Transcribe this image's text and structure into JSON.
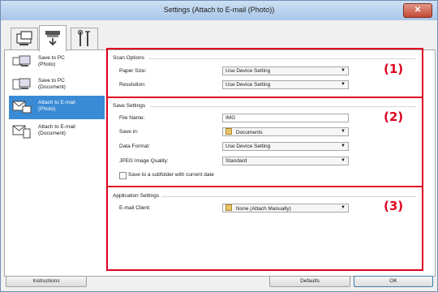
{
  "window": {
    "title": "Settings (Attach to E-mail (Photo))"
  },
  "tabs": [
    {
      "name": "scan-from-computer",
      "active": false
    },
    {
      "name": "scan-from-panel",
      "active": true
    },
    {
      "name": "general-settings",
      "active": false
    }
  ],
  "sidebar": {
    "items": [
      {
        "label": "Save to PC\n(Photo)",
        "selected": false
      },
      {
        "label": "Save to PC\n(Document)",
        "selected": false
      },
      {
        "label": "Attach to E-mail\n(Photo)",
        "selected": true
      },
      {
        "label": "Attach to E-mail\n(Document)",
        "selected": false
      }
    ]
  },
  "scan_options": {
    "title": "Scan Options",
    "paper_size_label": "Paper Size:",
    "paper_size_value": "Use Device Setting",
    "resolution_label": "Resolution:",
    "resolution_value": "Use Device Setting",
    "marker": "(1)"
  },
  "save_settings": {
    "title": "Save Settings",
    "file_name_label": "File Name:",
    "file_name_value": "IMG",
    "save_in_label": "Save in:",
    "save_in_value": "Documents",
    "data_format_label": "Data Format:",
    "data_format_value": "Use Device Setting",
    "jpeg_quality_label": "JPEG Image Quality:",
    "jpeg_quality_value": "Standard",
    "subfolder_label": "Save to a subfolder with current date",
    "subfolder_checked": false,
    "marker": "(2)"
  },
  "application_settings": {
    "title": "Application Settings",
    "email_client_label": "E-mail Client:",
    "email_client_value": "None (Attach Manually)",
    "marker": "(3)"
  },
  "footer": {
    "instructions_label": "Instructions",
    "defaults_label": "Defaults",
    "ok_label": "OK"
  },
  "colors": {
    "highlight_box": "#e00020",
    "selection": "#3a8bd6"
  }
}
